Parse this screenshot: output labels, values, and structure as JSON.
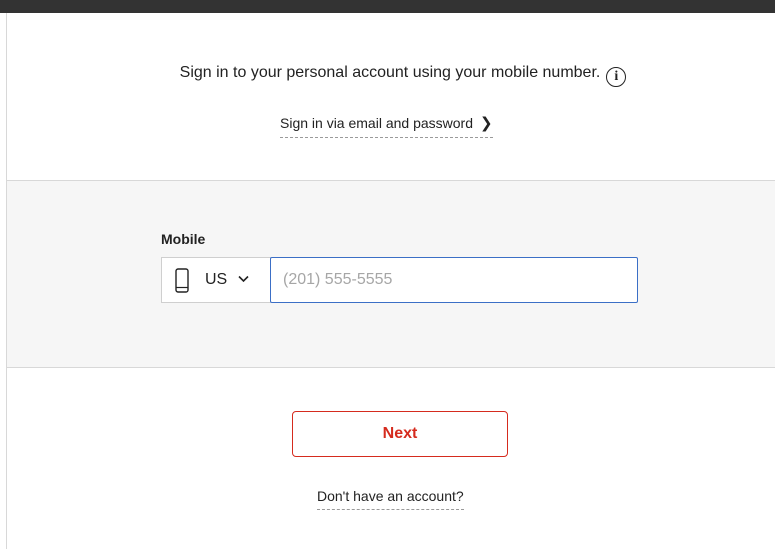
{
  "intro": {
    "text": "Sign in to your personal account using your mobile number.",
    "info_icon": "info-icon",
    "info_glyph": "i"
  },
  "email_link": {
    "label": "Sign in via email and password",
    "chevron": "❯"
  },
  "form": {
    "mobile_label": "Mobile",
    "country": {
      "selected": "US",
      "icon": "mobile-phone-icon"
    },
    "phone": {
      "value": "",
      "placeholder": "(201) 555-5555"
    }
  },
  "next_button": {
    "label": "Next"
  },
  "signup_link": {
    "label": "Don't have an account?"
  },
  "colors": {
    "accent": "#d52b1e",
    "focus": "#3b6fc6",
    "topbar": "#333333",
    "band": "#f6f6f6"
  }
}
